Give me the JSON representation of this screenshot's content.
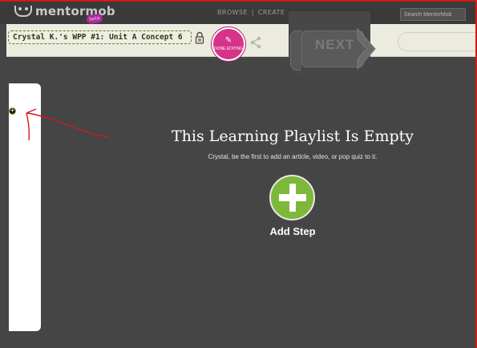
{
  "app": {
    "logo_text": "mentormob",
    "beta_badge": "beta"
  },
  "nav": {
    "browse_label": "BROWSE",
    "separator": "|",
    "create_label": "CREATE"
  },
  "search": {
    "placeholder": "Search MentorMob"
  },
  "toolbar": {
    "playlist_title": "Crystal K.'s WPP #1: Unit A Concept 6",
    "done_editing_label": "DONE EDITING",
    "next_label": "NEXT"
  },
  "empty_state": {
    "title": "This Learning Playlist Is Empty",
    "subtitle": "Crystal, be the first to add an article, video, or pop quiz to it.",
    "add_step_label": "Add Step"
  },
  "icons": {
    "logo": "mentormob-logo-icon",
    "lock": "lock-icon",
    "pencil": "pencil-icon",
    "share": "share-icon",
    "next_arrow": "chevron-right-icon",
    "add_step": "plus-icon",
    "sidebar_add": "plus-circle-icon"
  },
  "colors": {
    "accent_green": "#7db83a",
    "done_pink": "#d6338a",
    "annotation_red": "#d01a1a",
    "background": "#454545"
  }
}
